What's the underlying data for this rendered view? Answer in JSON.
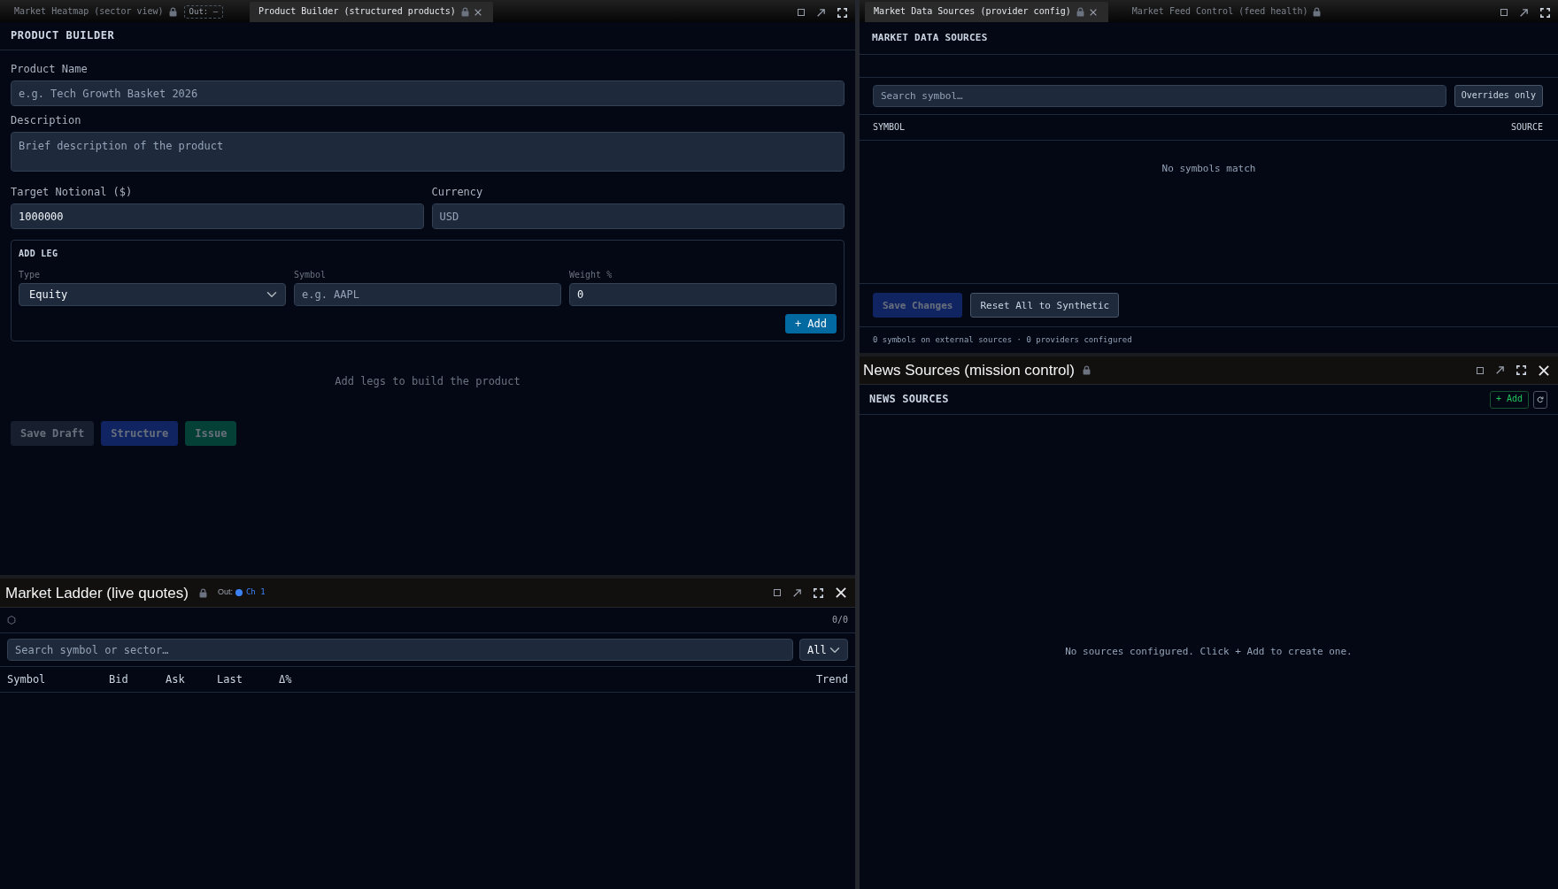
{
  "left_pane": {
    "tabs": [
      {
        "label": "Market Heatmap (sector view)",
        "selected": false,
        "locked": true,
        "closable": false,
        "output": "Out: –"
      },
      {
        "label": "Product Builder (structured products)",
        "selected": true,
        "locked": true,
        "closable": true
      }
    ],
    "product_builder": {
      "title": "PRODUCT BUILDER",
      "rows": [
        {
          "fields": [
            {
              "label": "Product Name",
              "kind": "input",
              "placeholder": "e.g. Tech Growth Basket 2026"
            }
          ]
        },
        {
          "fields": [
            {
              "label": "Description",
              "kind": "textarea",
              "placeholder": "Brief description of the product"
            }
          ]
        },
        {
          "fields": [
            {
              "label": "Target Notional ($)",
              "kind": "input",
              "value": "1000000"
            },
            {
              "label": "Currency",
              "kind": "input",
              "placeholder": "USD"
            }
          ]
        }
      ],
      "add_leg": {
        "title": "ADD LEG",
        "fields": [
          {
            "label": "Type",
            "kind": "select",
            "value": "Equity"
          },
          {
            "label": "Symbol",
            "kind": "input",
            "placeholder": "e.g. AAPL"
          },
          {
            "label": "Weight %",
            "kind": "input",
            "value": "0"
          }
        ],
        "button": {
          "label": "+ Add",
          "kind": "info",
          "disabled": false
        }
      },
      "empty_message": "Add legs to build the product",
      "actions": [
        {
          "label": "Save Draft",
          "kind": "secondary",
          "disabled": true
        },
        {
          "label": "Structure",
          "kind": "primary",
          "disabled": true
        },
        {
          "label": "Issue",
          "kind": "success",
          "disabled": true
        }
      ]
    }
  },
  "market_ladder": {
    "title": "Market Ladder (live quotes)",
    "locked": true,
    "output": {
      "label": "Out:",
      "channel": "Ch 1",
      "color": "#3b82f6"
    },
    "count": "0/0",
    "search": {
      "placeholder": "Search symbol or sector…"
    },
    "filter": {
      "value": "All"
    },
    "columns": [
      "Symbol",
      "Bid",
      "Ask",
      "Last",
      "Δ%",
      "Trend"
    ]
  },
  "right_pane": {
    "tabs": [
      {
        "label": "Market Data Sources (provider config)",
        "selected": true,
        "locked": true,
        "closable": true
      },
      {
        "label": "Market Feed Control (feed health)",
        "selected": false,
        "locked": true,
        "closable": false
      }
    ],
    "market_data_sources": {
      "title": "MARKET DATA SOURCES",
      "search": {
        "placeholder": "Search symbol…"
      },
      "overrides_toggle": {
        "label": "Overrides only",
        "on": false
      },
      "columns": [
        "SYMBOL",
        "SOURCE"
      ],
      "empty_message": "No symbols match",
      "actions": [
        {
          "label": "Save Changes",
          "kind": "primary",
          "disabled": true
        },
        {
          "label": "Reset All to Synthetic",
          "kind": "outline",
          "disabled": false
        }
      ],
      "summary": "0 symbols on external sources · 0 providers configured"
    }
  },
  "news_sources": {
    "title": "News Sources (mission control)",
    "locked": true,
    "heading": "NEWS SOURCES",
    "add_button": "+ Add",
    "empty_message": "No sources configured. Click + Add to create one."
  }
}
